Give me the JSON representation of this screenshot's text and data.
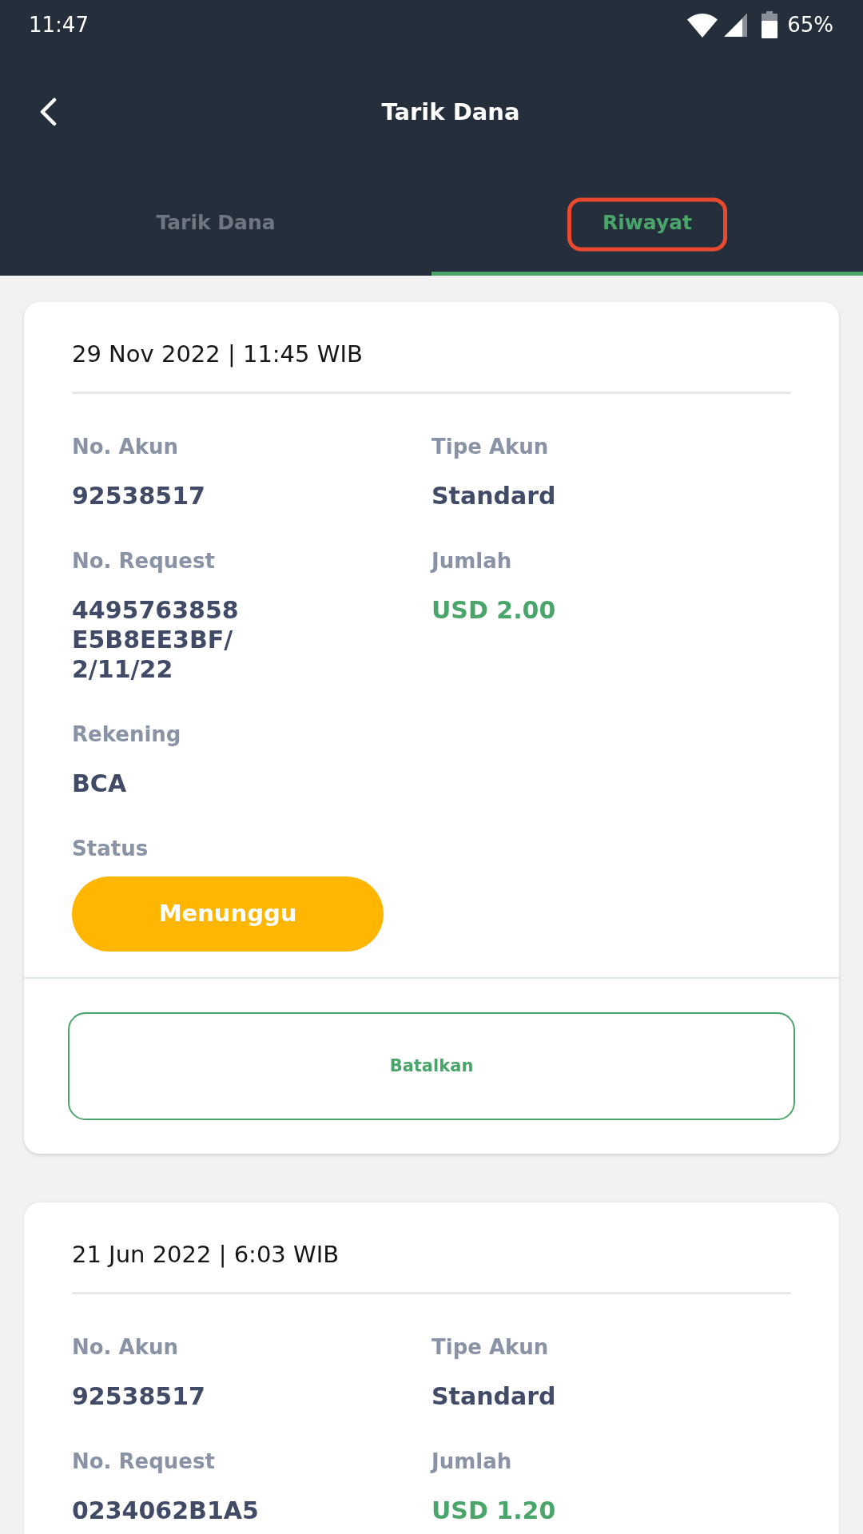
{
  "status_bar": {
    "time": "11:47",
    "battery": "65%"
  },
  "app_bar": {
    "title": "Tarik Dana"
  },
  "tabs": [
    {
      "label": "Tarik Dana",
      "selected": false,
      "highlighted": false
    },
    {
      "label": "Riwayat",
      "selected": true,
      "highlighted": true
    }
  ],
  "transactions": [
    {
      "datetime": "29 Nov 2022 | 11:45 WIB",
      "fields": [
        {
          "kind": "text",
          "label": "No. Akun",
          "value": "92538517"
        },
        {
          "kind": "text",
          "label": "Tipe Akun",
          "value": "Standard"
        },
        {
          "kind": "text",
          "label": "No. Request",
          "value": "4495763858\nE5B8EE3BF/\n2/11/22"
        },
        {
          "kind": "amount",
          "label": "Jumlah",
          "value": "USD 2.00"
        },
        {
          "kind": "text",
          "label": "Rekening",
          "value": "BCA"
        },
        {
          "kind": "status",
          "label": "Status",
          "value": "Menunggu"
        }
      ],
      "cancel_button": "Batalkan"
    },
    {
      "datetime": "21 Jun 2022 | 6:03 WIB",
      "fields": [
        {
          "kind": "text",
          "label": "No. Akun",
          "value": "92538517"
        },
        {
          "kind": "text",
          "label": "Tipe Akun",
          "value": "Standard"
        },
        {
          "kind": "text",
          "label": "No. Request",
          "value": "0234062B1A5"
        },
        {
          "kind": "amount",
          "label": "Jumlah",
          "value": "USD 1.20"
        }
      ]
    }
  ]
}
